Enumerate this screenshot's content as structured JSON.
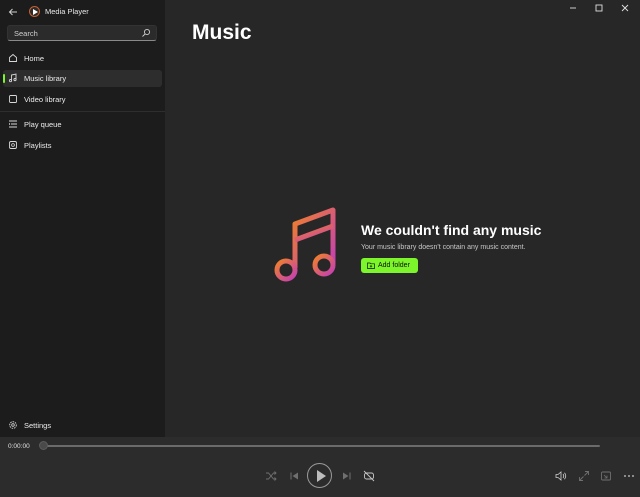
{
  "app": {
    "title": "Media Player"
  },
  "search": {
    "placeholder": "Search"
  },
  "nav": {
    "items": [
      {
        "label": "Home",
        "icon": "home-icon"
      },
      {
        "label": "Music library",
        "icon": "music-note-icon",
        "active": true
      },
      {
        "label": "Video library",
        "icon": "video-icon"
      },
      {
        "label": "Play queue",
        "icon": "queue-icon"
      },
      {
        "label": "Playlists",
        "icon": "playlist-icon"
      }
    ],
    "settings_label": "Settings"
  },
  "main": {
    "page_title": "Music",
    "empty_heading": "We couldn't find any music",
    "empty_subtext": "Your music library doesn't contain any music content.",
    "add_folder_label": "Add folder"
  },
  "player": {
    "current_time": "0:00:00",
    "progress": 0
  },
  "colors": {
    "accent": "#7cf52a",
    "sidebar_bg": "#1c1c1c",
    "main_bg": "#272727",
    "player_bg": "#2c2c2c",
    "art_gradient_start": "#f0802a",
    "art_gradient_end": "#c43fb5"
  }
}
